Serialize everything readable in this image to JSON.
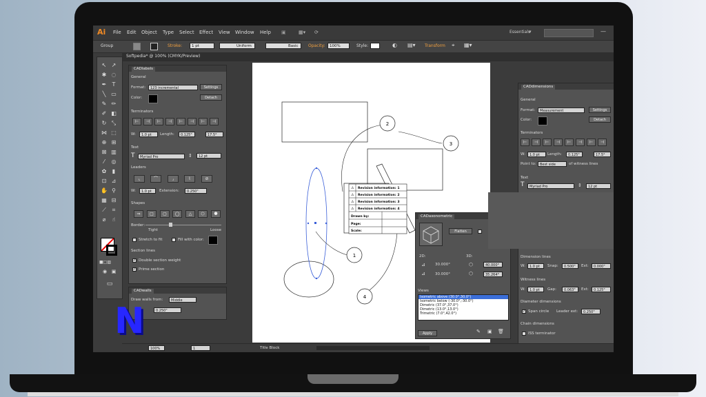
{
  "app": {
    "logo": "Ai",
    "menu": [
      "File",
      "Edit",
      "Object",
      "Type",
      "Select",
      "Effect",
      "View",
      "Window",
      "Help"
    ],
    "workspace": "Essentials",
    "window_buttons": [
      "—",
      "◻",
      "✕"
    ]
  },
  "controlbar": {
    "group": "Group",
    "stroke_label": "Stroke:",
    "stroke_weight": "1 pt",
    "uniform": "Uniform",
    "basic": "Basic",
    "opacity_label": "Opacity:",
    "opacity_value": "100%",
    "style_label": "Style:",
    "transform": "Transform"
  },
  "document": {
    "tab_title": "Softpedia* @ 100% (CMYK/Preview)",
    "zoom": "100%",
    "page": "1",
    "status": "Title Block"
  },
  "cadlabels": {
    "title": "CADlabels",
    "general": "General",
    "format_label": "Format:",
    "format_value": "123 incremental",
    "settings": "Settings",
    "color_label": "Color:",
    "detach": "Detach",
    "terminators": "Terminators",
    "w_label": "W:",
    "w_value": "1.0 pt",
    "length_label": "Length:",
    "length_value": "0.125\"",
    "angle_value": "17.5°",
    "text": "Text",
    "font": "Myriad Pro",
    "size": "12 pt",
    "leaders": "Leaders",
    "w2_value": "1.0 pt",
    "extension_label": "Extension:",
    "extension_value": "0.250\"",
    "shapes": "Shapes",
    "border": "Border:",
    "tight": "Tight",
    "loose": "Loose",
    "stretch": "Stretch to fit",
    "fill_with_color": "Fill with color:",
    "section_lines": "Section lines",
    "double_weight": "Double section weight",
    "prime_section": "Prime section"
  },
  "cadwalls": {
    "title": "CADwalls",
    "draw_walls_from": "Draw walls from:",
    "draw_value": "Middle",
    "thickness": "0.250\""
  },
  "cadaxonometric": {
    "title": "CADaxonometric",
    "flatten": "Flatten",
    "label_2d": "2D:",
    "label_3d": "3D:",
    "val_2d_a": "30.000°",
    "val_2d_b": "30.000°",
    "val_3d_a": "40.000°",
    "val_3d_b": "35.264°",
    "views": "Views",
    "view_list": [
      "Isometric above (30.0°,30.0°)",
      "Isometric below (-30.0°,-30.0°)",
      "Dimetric (37.0°,37.0°)",
      "Dimetric (13.0°,13.0°)",
      "Trimetric (7.0°,42.0°)"
    ],
    "apply": "Apply"
  },
  "caddimensions": {
    "title": "CADdimensions",
    "general": "General",
    "format_label": "Format:",
    "format_value": "Measurement",
    "settings": "Settings",
    "color_label": "Color:",
    "detach": "Detach",
    "terminators": "Terminators",
    "w_label": "W:",
    "w_value": "1.0 pt",
    "length_label": "Length:",
    "length_value": "0.125\"",
    "angle_value": "17.5°",
    "point_to": "Point to:",
    "point_value": "Best side",
    "of_witness": "of witness lines",
    "text": "Text",
    "font": "Myriad Pro",
    "size": "12 pt",
    "dimension_lines": "Dimension lines",
    "dim_w": "1.0 pt",
    "snap_label": "Snap:",
    "snap_value": "0.500\"",
    "ext_label": "Ext:",
    "ext_value": "0.000\"",
    "witness_lines": "Witness lines",
    "wit_w": "1.0 pt",
    "gap_label": "Gap:",
    "gap_value": "0.063\"",
    "wit_ext": "0.125\"",
    "diameter_dims": "Diameter dimensions",
    "span_circle": "Span circle",
    "leader_ext_label": "Leader ext:",
    "leader_ext_value": "0.250\"",
    "chain_dims": "Chain dimensions",
    "iss_terminator": "ISS terminator"
  },
  "drawing": {
    "balloons": [
      "1",
      "2",
      "3",
      "4"
    ],
    "table_rows": [
      "Revision information: 1",
      "Revision information: 2",
      "Revision information: 3",
      "Revision information: 4",
      "Drawn by:",
      "Page:",
      "Scale:"
    ]
  },
  "watermark": "N"
}
